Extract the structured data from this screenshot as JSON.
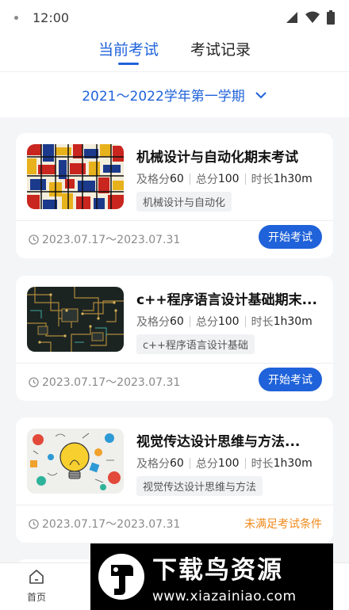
{
  "status": {
    "time": "12:00"
  },
  "tabs": [
    {
      "label": "当前考试",
      "active": true
    },
    {
      "label": "考试记录",
      "active": false
    }
  ],
  "term": {
    "label": "2021～2022学年第一学期"
  },
  "cards": [
    {
      "title": "机械设计与自动化期末考试",
      "pass_label": "及格分",
      "pass": "60",
      "total_label": "总分",
      "total": "100",
      "duration_label": "时长",
      "duration": "1h30m",
      "tag": "机械设计与自动化",
      "date": "2023.07.17～2023.07.31",
      "action": "开始考试",
      "action_type": "button",
      "thumb": "mondrian-grid"
    },
    {
      "title": "c++程序语言设计基础期末...",
      "pass_label": "及格分",
      "pass": "60",
      "total_label": "总分",
      "total": "100",
      "duration_label": "时长",
      "duration": "1h30m",
      "tag": "c++程序语言设计基础",
      "date": "2023.07.17～2023.07.31",
      "action": "开始考试",
      "action_type": "button",
      "thumb": "circuit-board"
    },
    {
      "title": "视觉传达设计思维与方法...",
      "pass_label": "及格分",
      "pass": "60",
      "total_label": "总分",
      "total": "100",
      "duration_label": "时长",
      "duration": "1h30m",
      "tag": "视觉传达设计思维与方法",
      "date": "2023.07.17～2023.07.31",
      "action": "未满足考试条件",
      "action_type": "text",
      "thumb": "lightbulb-doodles"
    }
  ],
  "bottom_nav": {
    "home_label": "首页"
  },
  "watermark": {
    "main": "下载鸟资源",
    "url": "www.xiazainiao.com"
  },
  "colors": {
    "accent": "#1f62d9",
    "warning": "#f08a1c",
    "background": "#f4f5f7"
  }
}
